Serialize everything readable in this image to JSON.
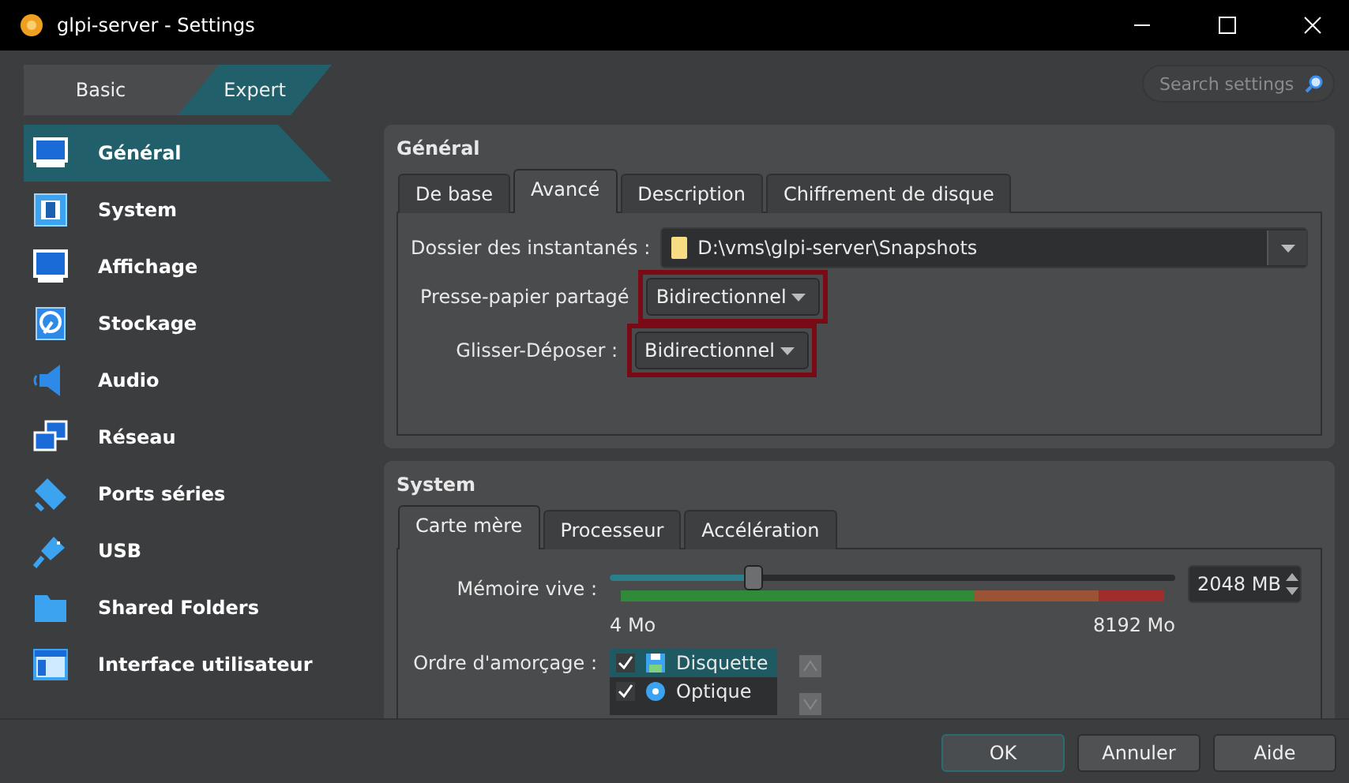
{
  "window": {
    "title": "glpi-server - Settings"
  },
  "mode_tabs": [
    {
      "label": "Basic",
      "selected": false
    },
    {
      "label": "Expert",
      "selected": true
    }
  ],
  "search": {
    "placeholder": "Search settings"
  },
  "sidebar": {
    "items": [
      {
        "label": "Général",
        "selected": true
      },
      {
        "label": "System",
        "selected": false
      },
      {
        "label": "Affichage",
        "selected": false
      },
      {
        "label": "Stockage",
        "selected": false
      },
      {
        "label": "Audio",
        "selected": false
      },
      {
        "label": "Réseau",
        "selected": false
      },
      {
        "label": "Ports séries",
        "selected": false
      },
      {
        "label": "USB",
        "selected": false
      },
      {
        "label": "Shared Folders",
        "selected": false
      },
      {
        "label": "Interface utilisateur",
        "selected": false
      }
    ]
  },
  "general": {
    "title": "Général",
    "tabs": [
      {
        "label": "De base",
        "selected": false
      },
      {
        "label": "Avancé",
        "selected": true
      },
      {
        "label": "Description",
        "selected": false
      },
      {
        "label": "Chiffrement de disque",
        "selected": false
      }
    ],
    "snapshot_folder": {
      "label": "Dossier des instantanés :",
      "value": "D:\\vms\\glpi-server\\Snapshots"
    },
    "combos": [
      {
        "label": "Presse-papier partagé",
        "value": "Bidirectionnel",
        "highlighted": true
      },
      {
        "label": "Glisser-Déposer :",
        "value": "Bidirectionnel",
        "highlighted": true
      }
    ]
  },
  "system": {
    "title": "System",
    "tabs": [
      {
        "label": "Carte mère",
        "selected": true
      },
      {
        "label": "Processeur",
        "selected": false
      },
      {
        "label": "Accélération",
        "selected": false
      }
    ],
    "memory": {
      "label": "Mémoire vive :",
      "level": 0.25,
      "value": "2048 MB",
      "min_label": "4 Mo",
      "max_label": "8192 Mo"
    },
    "boot_order": {
      "label": "Ordre d'amorçage :",
      "items": [
        {
          "label": "Disquette",
          "checked": true,
          "selected": true
        },
        {
          "label": "Optique",
          "checked": true,
          "selected": false
        }
      ]
    }
  },
  "buttons": [
    {
      "label": "OK",
      "default": true
    },
    {
      "label": "Annuler",
      "default": false
    },
    {
      "label": "Aide",
      "default": false
    }
  ]
}
